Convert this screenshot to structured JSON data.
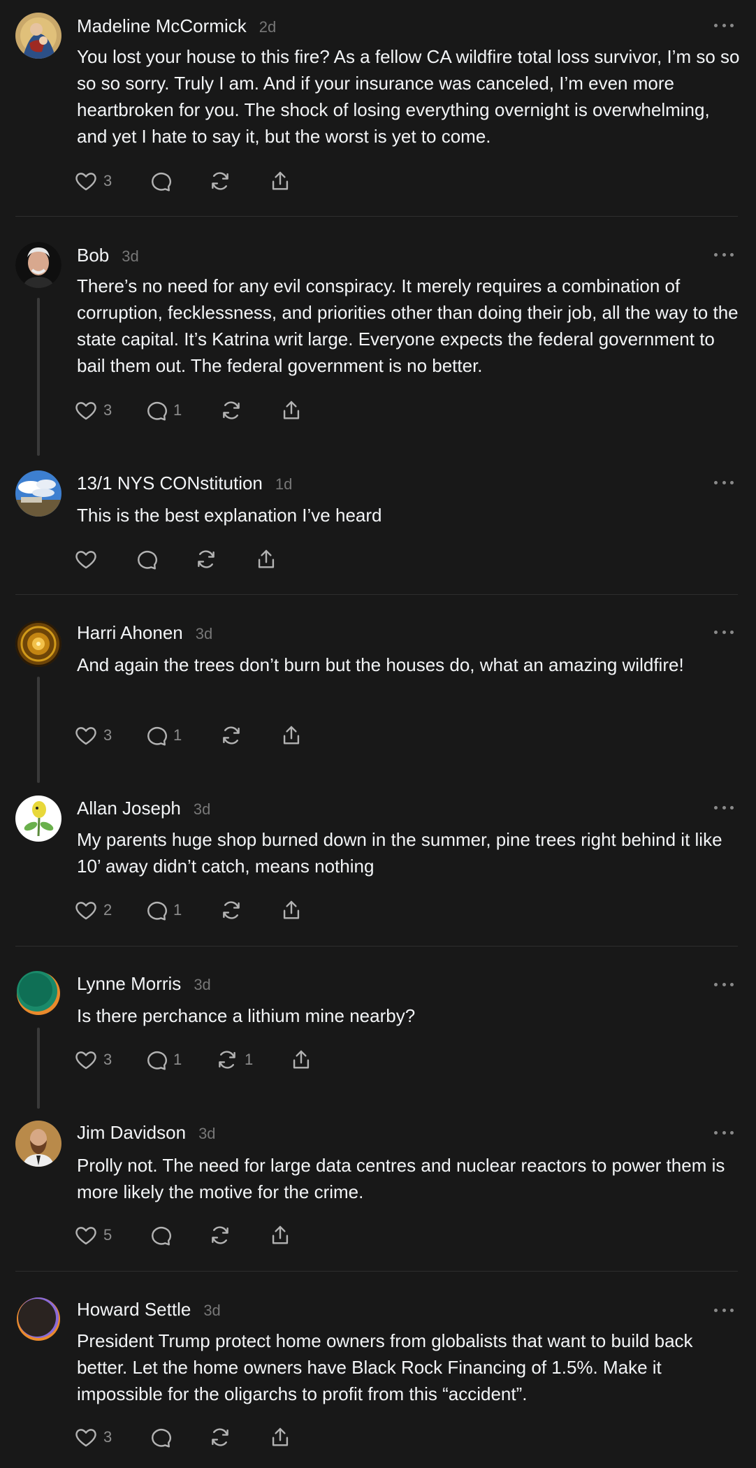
{
  "posts": [
    {
      "username": "Madeline McCormick",
      "time": "2d",
      "text": "You lost your house to this fire? As a fellow CA wildfire total loss survivor, I’m so so so so sorry. Truly I am. And if your insurance was canceled, I’m even more heartbroken for you. The shock of losing everything overnight is overwhelming, and yet I hate to say it, but the worst is yet to come.",
      "likes": "3",
      "replies": "",
      "reposts": "",
      "avatar_icon": "madonna-painting-avatar"
    },
    {
      "username": "Bob",
      "time": "3d",
      "text": "There’s no need for any evil conspiracy. It merely requires a combination of corruption, fecklessness, and priorities other than doing their job, all the way to the state capital. It’s Katrina writ large. Everyone expects the federal government to bail them out. The federal government is no better.",
      "likes": "3",
      "replies": "1",
      "reposts": "",
      "avatar_icon": "older-man-avatar"
    },
    {
      "username": "13/1 NYS CONstitution",
      "time": "1d",
      "text": "This is the best explanation I’ve heard",
      "likes": "",
      "replies": "",
      "reposts": "",
      "avatar_icon": "sky-landscape-avatar"
    },
    {
      "username": "Harri Ahonen",
      "time": "3d",
      "text": "And again the trees don’t burn but the houses do, what an amazing wildfire!",
      "likes": "3",
      "replies": "1",
      "reposts": "",
      "avatar_icon": "golden-mandala-avatar"
    },
    {
      "username": "Allan Joseph",
      "time": "3d",
      "text": "My parents huge shop burned down in the summer, pine trees right behind it like 10’ away didn’t catch, means nothing",
      "likes": "2",
      "replies": "1",
      "reposts": "",
      "avatar_icon": "plant-cartoon-avatar"
    },
    {
      "username": "Lynne Morris",
      "time": "3d",
      "text": "Is there perchance a lithium mine nearby?",
      "likes": "3",
      "replies": "1",
      "reposts": "1",
      "avatar_icon": "teal-orb-avatar"
    },
    {
      "username": "Jim Davidson",
      "time": "3d",
      "text": "Prolly not. The need for large data centres and nuclear reactors to power them is more likely the motive for the crime.",
      "likes": "5",
      "replies": "",
      "reposts": "",
      "avatar_icon": "bearded-man-avatar"
    },
    {
      "username": "Howard Settle",
      "time": "3d",
      "text": "President Trump protect home owners from globalists that want to build back better. Let the home owners have Black Rock Financing of 1.5%. Make it impossible for the oligarchs to profit from this “accident”.",
      "likes": "3",
      "replies": "",
      "reposts": "",
      "avatar_icon": "dark-orb-avatar"
    }
  ]
}
